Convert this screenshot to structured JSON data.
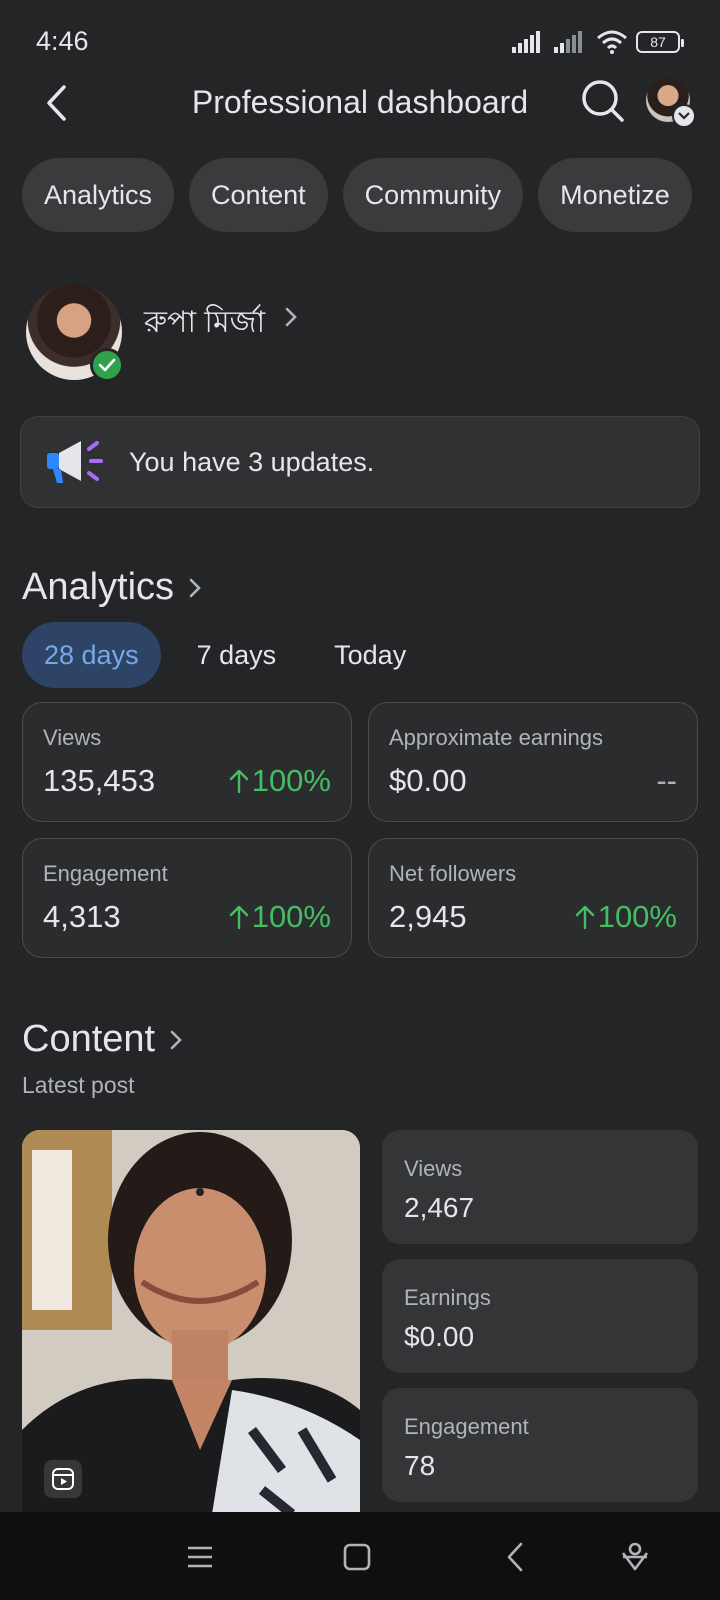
{
  "status_bar": {
    "time": "4:46",
    "battery": "87"
  },
  "header": {
    "title": "Professional dashboard"
  },
  "tabs": [
    {
      "label": "Analytics"
    },
    {
      "label": "Content"
    },
    {
      "label": "Community"
    },
    {
      "label": "Monetize"
    }
  ],
  "profile": {
    "name": "রুপা মির্জা"
  },
  "updates": {
    "text": "You have 3 updates."
  },
  "analytics": {
    "title": "Analytics",
    "ranges": [
      {
        "label": "28 days",
        "active": true
      },
      {
        "label": "7 days",
        "active": false
      },
      {
        "label": "Today",
        "active": false
      }
    ],
    "stats": [
      {
        "label": "Views",
        "value": "135,453",
        "change": "100%"
      },
      {
        "label": "Approximate earnings",
        "value": "$0.00",
        "change": "--"
      },
      {
        "label": "Engagement",
        "value": "4,313",
        "change": "100%"
      },
      {
        "label": "Net followers",
        "value": "2,945",
        "change": "100%"
      }
    ]
  },
  "content": {
    "title": "Content",
    "subtitle": "Latest post",
    "post_stats": [
      {
        "label": "Views",
        "value": "2,467"
      },
      {
        "label": "Earnings",
        "value": "$0.00"
      },
      {
        "label": "Engagement",
        "value": "78"
      }
    ]
  },
  "colors": {
    "background": "#242526",
    "positive": "#45bd62",
    "active_tab_bg": "#2d4466",
    "active_tab_text": "#7aa7e6"
  }
}
